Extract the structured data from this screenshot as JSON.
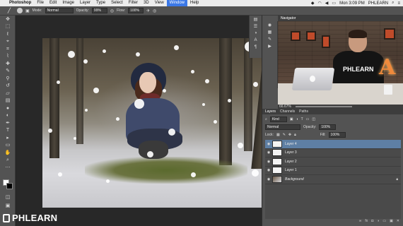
{
  "menubar": {
    "items": [
      "Photoshop",
      "File",
      "Edit",
      "Image",
      "Layer",
      "Type",
      "Select",
      "Filter",
      "3D",
      "View",
      "Window",
      "Help"
    ],
    "active_index": 10,
    "clock": "Mon 3:09 PM",
    "user": "PHLEARN"
  },
  "options": {
    "mode_label": "Mode:",
    "mode_value": "Normal",
    "opacity_label": "Opacity:",
    "opacity_value": "99%",
    "flow_label": "Flow:",
    "flow_value": "100%"
  },
  "navigator": {
    "tabs": [
      "Navigator"
    ],
    "zoom": "66.67%",
    "shirt_text": "PHLEARN",
    "letter": "A"
  },
  "layers": {
    "tabs": [
      "Layers",
      "Channels",
      "Paths"
    ],
    "kind_label": "Kind",
    "blend_mode": "Normal",
    "opacity_label": "Opacity:",
    "opacity_value": "100%",
    "lock_label": "Lock:",
    "fill_label": "Fill:",
    "fill_value": "100%",
    "rows": [
      {
        "name": "Layer 4",
        "active": true
      },
      {
        "name": "Layer 3",
        "active": false
      },
      {
        "name": "Layer 2",
        "active": false
      },
      {
        "name": "Layer 1",
        "active": false
      },
      {
        "name": "Background",
        "active": false
      }
    ]
  },
  "watermark": {
    "text": "PHLEARN"
  },
  "colors": {
    "selection": "#5e7fa4",
    "panel": "#535353",
    "menu_active": "#3b78e7"
  }
}
